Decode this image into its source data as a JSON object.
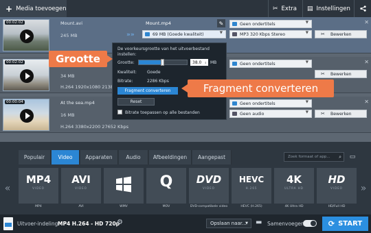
{
  "toolbar": {
    "add_media": "Media toevoegen",
    "extra": "Extra",
    "settings": "Instellingen"
  },
  "files": [
    {
      "time": "00:02:02",
      "name": "Mount.avi",
      "size": "245 MB",
      "output_name": "Mount.mp4",
      "output_size": "69 MB (Goede kwaliteit)",
      "subtitles": "Geen ondertitels",
      "audio": "MP3 320 Kbps Stereo",
      "edit": "Bewerken"
    },
    {
      "time": "00:02:02",
      "size": "34 MB",
      "info": "H.264 1920x1080 2138 K",
      "subtitles": "Geen ondertitels",
      "edit": "Bewerken"
    },
    {
      "time": "00:00:04",
      "name": "At the sea.mp4",
      "size": "16 MB",
      "info": "H.264 3380x2200 27652 Kbps",
      "subtitles": "Geen ondertitels",
      "audio": "Geen audio",
      "edit": "Bewerken"
    }
  ],
  "popup": {
    "description": "De voorkeursgrootte van het uitvoerbestand instellen:",
    "size_label": "Grootte:",
    "size_value": "38.0",
    "size_unit": "MB",
    "quality_label": "Kwaliteit:",
    "quality_value": "Goede",
    "bitrate_label": "Bitrate:",
    "bitrate_value": "2286 Kbps",
    "fragment_button": "Fragment converteren",
    "reset_button": "Reset",
    "apply_all": "Bitrate toepassen op alle bestanden",
    "slider_fraction": 0.48
  },
  "callouts": {
    "size": "Grootte",
    "fragment": "Fragment converteren"
  },
  "format_tabs": [
    "Populair",
    "Video",
    "Apparaten",
    "Audio",
    "Afbeeldingen",
    "Aangepast"
  ],
  "active_tab": "Video",
  "format_search_placeholder": "Zoek formaat of app...",
  "formats": [
    {
      "logo": "MP4",
      "sub": "VIDEO",
      "label": "MP4"
    },
    {
      "logo": "AVI",
      "sub": "VIDEO",
      "label": "AVI"
    },
    {
      "logo": "",
      "sub": "",
      "label": "WMV"
    },
    {
      "logo": "Q",
      "sub": "",
      "label": "MOV"
    },
    {
      "logo": "DVD",
      "sub": "VIDEO",
      "label": "DVD-compatibele video"
    },
    {
      "logo": "HEVC",
      "sub": "H.265",
      "label": "HEVC (H.265)"
    },
    {
      "logo": "4K",
      "sub": "ULTRA HD",
      "label": "4K Ultra HD"
    },
    {
      "logo": "HD",
      "sub": "VIDEO",
      "label": "HD/Full HD"
    }
  ],
  "bottom": {
    "output_label": "Uitvoer-indeling:",
    "output_value": "MP4 H.264 - HD 720p",
    "save_to": "Opslaan naar...",
    "merge": "Samenvoegen:",
    "start": "START"
  },
  "colors": {
    "accent": "#2b86d4",
    "callout": "#ee7a48",
    "start": "#2b8fe0"
  }
}
